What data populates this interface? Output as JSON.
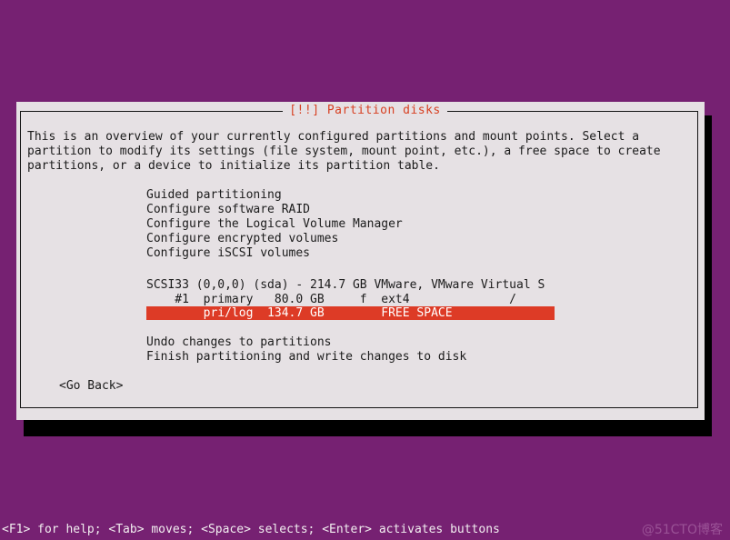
{
  "installer": {
    "background_color": "#762172",
    "dialog_bg_color": "#e6e1e4",
    "title": "[!!] Partition disks",
    "title_color": "#d74022",
    "highlight_color": "#dd3b26",
    "highlight_text_color": "#ffffff"
  },
  "intro": {
    "text": "This is an overview of your currently configured partitions and mount points. Select a\npartition to modify its settings (file system, mount point, etc.), a free space to create\npartitions, or a device to initialize its partition table."
  },
  "menu_top": {
    "text": "Guided partitioning\nConfigure software RAID\nConfigure the Logical Volume Manager\nConfigure encrypted volumes\nConfigure iSCSI volumes",
    "items": [
      "Guided partitioning",
      "Configure software RAID",
      "Configure the Logical Volume Manager",
      "Configure encrypted volumes",
      "Configure iSCSI volumes"
    ]
  },
  "disks": {
    "header": "SCSI33 (0,0,0) (sda) - 214.7 GB VMware, VMware Virtual S",
    "device": "SCSI33 (0,0,0) (sda)",
    "size": "214.7 GB",
    "model": "VMware, VMware Virtual S",
    "partitions": [
      {
        "row": "    #1  primary   80.0 GB     f  ext4              /",
        "number": "#1",
        "type": "primary",
        "size": "80.0 GB",
        "flags": "f",
        "filesystem": "ext4",
        "mountpoint": "/",
        "selected": false
      },
      {
        "row": "        pri/log  134.7 GB        FREE SPACE",
        "number": "",
        "type": "pri/log",
        "size": "134.7 GB",
        "flags": "",
        "filesystem": "FREE SPACE",
        "mountpoint": "",
        "selected": true
      }
    ]
  },
  "menu_bottom": {
    "text": "Undo changes to partitions\nFinish partitioning and write changes to disk",
    "items": [
      "Undo changes to partitions",
      "Finish partitioning and write changes to disk"
    ]
  },
  "buttons": {
    "go_back": "<Go Back>"
  },
  "help_bar": {
    "text": "<F1> for help; <Tab> moves; <Space> selects; <Enter> activates buttons",
    "watermark": "@51CTO博客"
  }
}
